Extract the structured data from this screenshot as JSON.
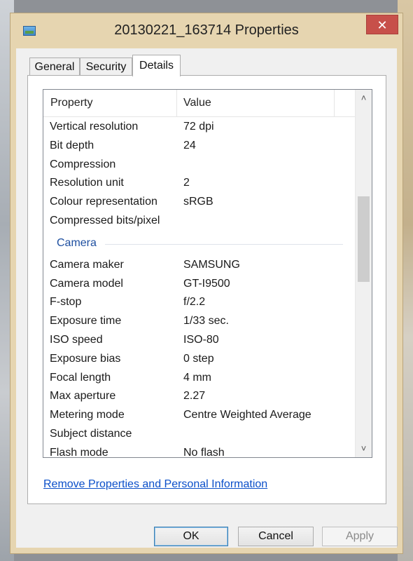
{
  "window": {
    "title": "20130221_163714 Properties",
    "close_label": "✕"
  },
  "tabs": [
    {
      "label": "General"
    },
    {
      "label": "Security"
    },
    {
      "label": "Details"
    }
  ],
  "list": {
    "header_property": "Property",
    "header_value": "Value",
    "rows_top": [
      {
        "property": "Vertical resolution",
        "value": "72 dpi"
      },
      {
        "property": "Bit depth",
        "value": "24"
      },
      {
        "property": "Compression",
        "value": ""
      },
      {
        "property": "Resolution unit",
        "value": "2"
      },
      {
        "property": "Colour representation",
        "value": "sRGB"
      },
      {
        "property": "Compressed bits/pixel",
        "value": ""
      }
    ],
    "group_camera": "Camera",
    "rows_camera": [
      {
        "property": "Camera maker",
        "value": "SAMSUNG"
      },
      {
        "property": "Camera model",
        "value": "GT-I9500"
      },
      {
        "property": "F-stop",
        "value": "f/2.2"
      },
      {
        "property": "Exposure time",
        "value": "1/33 sec."
      },
      {
        "property": "ISO speed",
        "value": "ISO-80"
      },
      {
        "property": "Exposure bias",
        "value": "0 step"
      },
      {
        "property": "Focal length",
        "value": "4 mm"
      },
      {
        "property": "Max aperture",
        "value": "2.27"
      },
      {
        "property": "Metering mode",
        "value": "Centre Weighted Average"
      },
      {
        "property": "Subject distance",
        "value": ""
      },
      {
        "property": "Flash mode",
        "value": "No flash"
      }
    ],
    "scroll_up_icon": "chevron-up-icon",
    "scroll_down_icon": "chevron-down-icon"
  },
  "link_remove": "Remove Properties and Personal Information",
  "buttons": {
    "ok": "OK",
    "cancel": "Cancel",
    "apply": "Apply"
  },
  "colors": {
    "titlebar": "#e6d5b0",
    "close": "#c7504a",
    "link": "#0b4fc9",
    "group_heading": "#1e4fa0"
  }
}
